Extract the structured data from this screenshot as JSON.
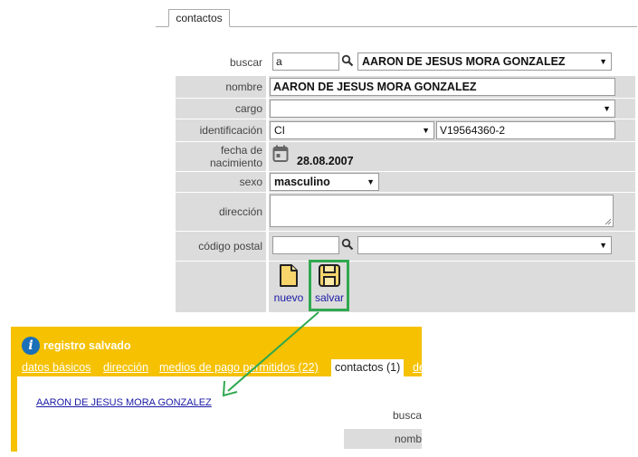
{
  "top_tab": {
    "label": "contactos"
  },
  "form": {
    "buscar": {
      "label": "buscar",
      "query": "a",
      "selected": "AARON DE JESUS MORA GONZALEZ"
    },
    "nombre": {
      "label": "nombre",
      "value": "AARON DE JESUS MORA GONZALEZ"
    },
    "cargo": {
      "label": "cargo",
      "selected": ""
    },
    "identificacion": {
      "label": "identificación",
      "type": "CI",
      "number": "V19564360-2"
    },
    "fecha": {
      "label_1": "fecha de",
      "label_2": "nacimiento",
      "value": "28.08.2007"
    },
    "sexo": {
      "label": "sexo",
      "selected": "masculino"
    },
    "direccion": {
      "label": "dirección",
      "value": ""
    },
    "codigo_postal": {
      "label": "código postal",
      "value": "",
      "selected": ""
    }
  },
  "toolbar": {
    "new_label": "nuevo",
    "save_label": "salvar"
  },
  "panel": {
    "message": "registro salvado",
    "tabs": [
      {
        "label": "datos básicos"
      },
      {
        "label": "dirección"
      },
      {
        "label": "medios de pago permitidos (22)"
      },
      {
        "label": "contactos (1)"
      },
      {
        "label": "de"
      }
    ],
    "contact_link": "AARON DE JESUS MORA GONZALEZ",
    "buscar_label": "busca",
    "nombre_label": "nomb"
  },
  "colors": {
    "accent_yellow": "#f5c100",
    "highlight_green": "#2fa84f",
    "row_gray": "#dcdcdc",
    "link_blue": "#1a1aa6"
  },
  "icons": [
    "search-icon",
    "calendar-icon",
    "new-document-icon",
    "save-disk-icon",
    "info-icon",
    "arrow-annotation"
  ]
}
